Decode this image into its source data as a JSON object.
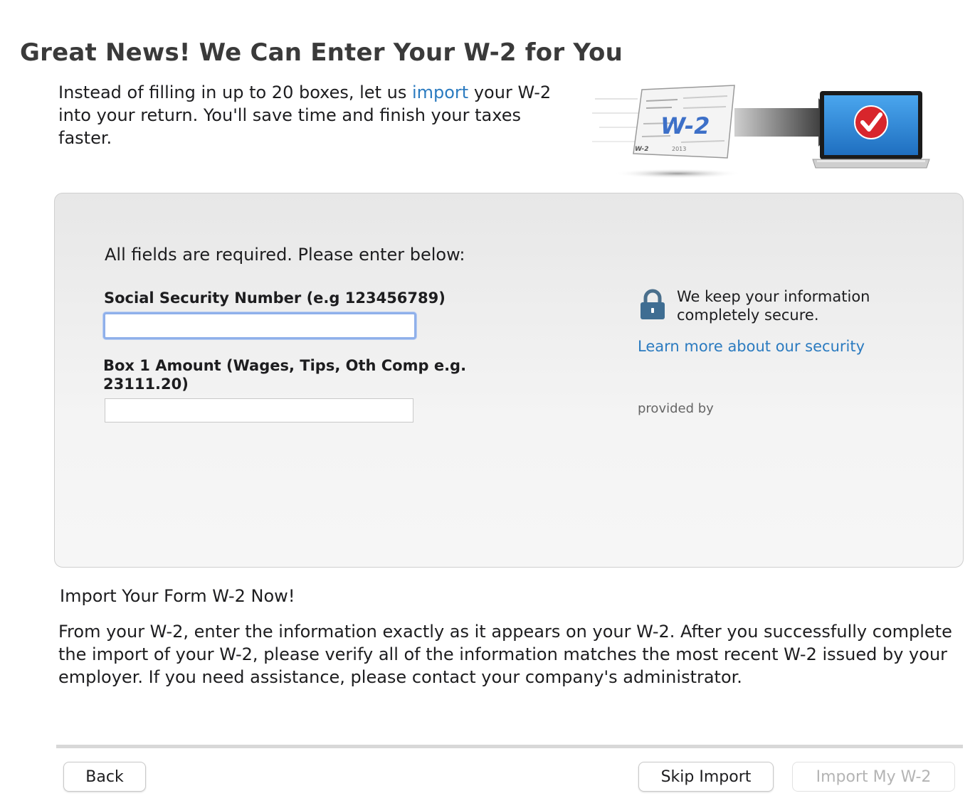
{
  "header": {
    "title": "Great News! We Can Enter Your W-2 for You",
    "intro_before": "Instead of filling in up to 20 boxes, let us ",
    "intro_link": "import",
    "intro_after": " your W-2 into your return. You'll save time and finish your taxes faster."
  },
  "hero": {
    "form_label": "W-2",
    "form_year": "2013",
    "accent_color": "#2b7bc0",
    "check_color": "#d8262c"
  },
  "form": {
    "instructions": "All fields are required. Please enter below:",
    "ssn_label": "Social Security Number (e.g 123456789)",
    "ssn_value": "",
    "box1_label": "Box 1 Amount (Wages, Tips, Oth Comp e.g. 23111.20)",
    "box1_value": ""
  },
  "security": {
    "icon": "lock-icon",
    "message": "We keep your information completely secure.",
    "link": "Learn more about our security",
    "provided_by": "provided by"
  },
  "info": {
    "subheading": "Import Your Form W-2 Now!",
    "body": "From your W-2, enter the information exactly as it appears on your W-2. After you successfully complete the import of your W-2, please verify all of the information matches the most recent W-2 issued by your employer. If you need assistance, please contact your company's administrator."
  },
  "footer": {
    "back": "Back",
    "skip": "Skip Import",
    "import": "Import My W-2",
    "import_enabled": false
  }
}
